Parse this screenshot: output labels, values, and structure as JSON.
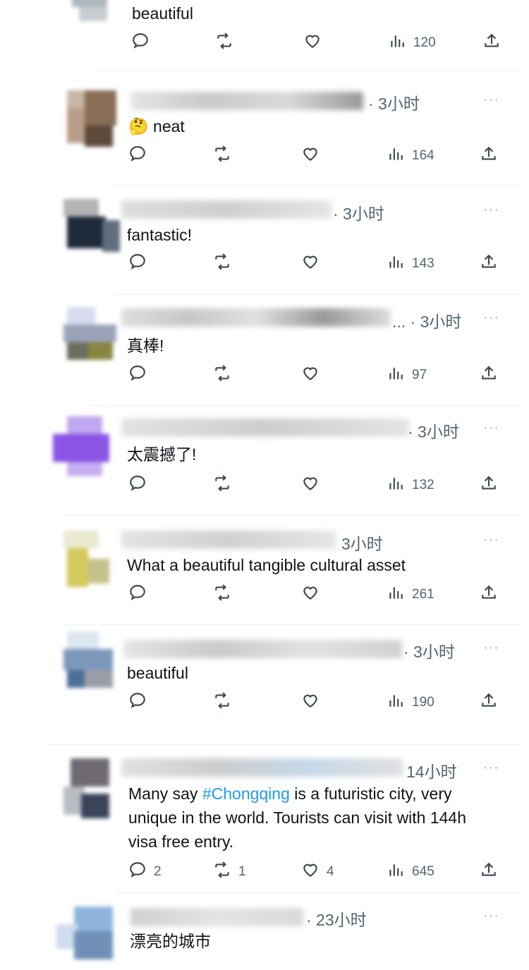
{
  "replies": [
    {
      "handle_suffix": "",
      "time": "",
      "text": "beautiful",
      "replies_count": "",
      "retweets_count": "",
      "likes_count": "",
      "views": "120"
    },
    {
      "handle_suffix": "· 3小时",
      "time": "",
      "text": "🤔 neat",
      "replies_count": "",
      "retweets_count": "",
      "likes_count": "",
      "views": "164"
    },
    {
      "handle_suffix": "· 3小时",
      "time": "",
      "text": "fantastic!",
      "replies_count": "",
      "retweets_count": "",
      "likes_count": "",
      "views": "143"
    },
    {
      "handle_suffix": "... · 3小时",
      "time": "",
      "text": "真棒!",
      "replies_count": "",
      "retweets_count": "",
      "likes_count": "",
      "views": "97"
    },
    {
      "handle_suffix": "· 3小时",
      "time": "",
      "text": "太震撼了!",
      "replies_count": "",
      "retweets_count": "",
      "likes_count": "",
      "views": "132"
    },
    {
      "handle_suffix": "3小时",
      "time": "",
      "text": "What a beautiful tangible cultural asset",
      "replies_count": "",
      "retweets_count": "",
      "likes_count": "",
      "views": "261"
    },
    {
      "handle_suffix": "· 3小时",
      "time": "",
      "text": "beautiful",
      "replies_count": "",
      "retweets_count": "",
      "likes_count": "",
      "views": "190"
    },
    {
      "handle_suffix": "14小时",
      "time": "",
      "text_before": "Many say ",
      "hashtag": "#Chongqing",
      "text_after": " is a futuristic city, very unique in the world. Tourists can visit with 144h visa free entry.",
      "replies_count": "2",
      "retweets_count": "1",
      "likes_count": "4",
      "views": "645"
    },
    {
      "handle_suffix": "· 23小时",
      "time": "",
      "text": "漂亮的城市",
      "replies_count": "",
      "retweets_count": "",
      "likes_count": "",
      "views": ""
    }
  ],
  "more_label": "···",
  "icons": {
    "reply": "reply-icon",
    "retweet": "retweet-icon",
    "like": "heart-icon",
    "views": "views-chart-icon",
    "share": "share-icon"
  },
  "colors": {
    "text": "#0f1419",
    "secondary": "#536471",
    "hashtag": "#1d9bf0",
    "divider": "#eceff1"
  }
}
